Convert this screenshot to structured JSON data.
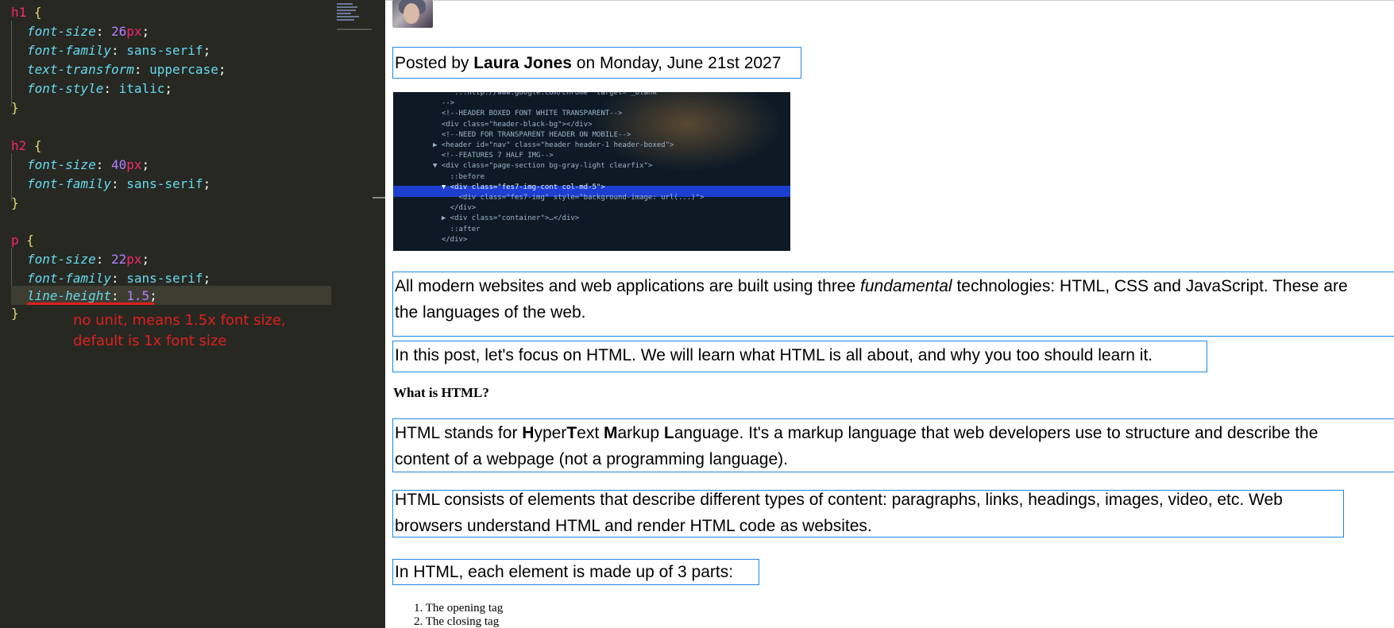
{
  "editor": {
    "lines": {
      "h1_open": "h1",
      "h1_fs_prop": "font-size",
      "h1_fs_num": "26",
      "h1_fs_unit": "px",
      "h1_ff_prop": "font-family",
      "h1_ff_val": "sans-serif",
      "h1_tt_prop": "text-transform",
      "h1_tt_val": "uppercase",
      "h1_fst_prop": "font-style",
      "h1_fst_val": "italic",
      "h2_open": "h2",
      "h2_fs_prop": "font-size",
      "h2_fs_num": "40",
      "h2_fs_unit": "px",
      "h2_ff_prop": "font-family",
      "h2_ff_val": "sans-serif",
      "p_open": "p",
      "p_fs_prop": "font-size",
      "p_fs_num": "22",
      "p_fs_unit": "px",
      "p_ff_prop": "font-family",
      "p_ff_val": "sans-serif",
      "p_lh_prop": "line-height",
      "p_lh_num": "1.5"
    },
    "annotation": "no unit, means 1.5x font size,\ndefault is 1x font size",
    "colors": {
      "background": "#272822",
      "selector": "#f92672",
      "property": "#66d9ef",
      "number": "#ae81ff",
      "brace": "#e6db74",
      "annotation": "#e0201e"
    }
  },
  "preview": {
    "posted": {
      "prefix": "Posted by ",
      "author": "Laura Jones",
      "suffix": " on Monday, June 21st 2027"
    },
    "hero_code": [
      "     ...http://www.google.com/chrome\" target=\"_blank\"",
      "  -->",
      "  <!--HEADER BOXED FONT WHITE TRANSPARENT-->",
      "  <div class=\"header-black-bg\"></div>",
      "  <!--NEED FOR TRANSPARENT HEADER ON MOBILE-->",
      "▶ <header id=\"nav\" class=\"header header-1 header-boxed\">",
      "  <!--FEATURES 7 HALF IMG-->",
      "▼ <div class=\"page-section bg-gray-light clearfix\">",
      "    ::before",
      "  ▼ <div class=\"fes7-img-cont col-md-5\">",
      "      <div class=\"fes7-img\" style=\"background-image: url(...)\">",
      "    </div>",
      "  ▶ <div class=\"container\">…</div>",
      "    ::after",
      "  </div>"
    ],
    "para1": {
      "before_em": "All modern websites and web applications are built using three ",
      "em": "fundamental",
      "after_em": " technologies: HTML, CSS and JavaScript. These are",
      "line2": "the languages of the web."
    },
    "para2": "In this post, let's focus on HTML. We will learn what HTML is all about, and why you too should learn it.",
    "heading_what": "What is HTML?",
    "para3": {
      "t1": "HTML stands for ",
      "b1": "H",
      "t2": "yper",
      "b2": "T",
      "t3": "ext ",
      "b3": "M",
      "t4": "arkup ",
      "b4": "L",
      "t5": "anguage. It's a markup language that web developers use to structure and describe the",
      "line2": "content of a webpage (not a programming language)."
    },
    "para4": {
      "line1": "HTML consists of elements that describe different types of content: paragraphs, links, headings, images, video, etc. Web",
      "line2": "browsers understand HTML and render HTML code as websites."
    },
    "para5": "In HTML, each element is made up of 3 parts:",
    "parts": [
      "1. The opening tag",
      "2. The closing tag"
    ],
    "colors": {
      "outline": "#1e88e5"
    }
  }
}
